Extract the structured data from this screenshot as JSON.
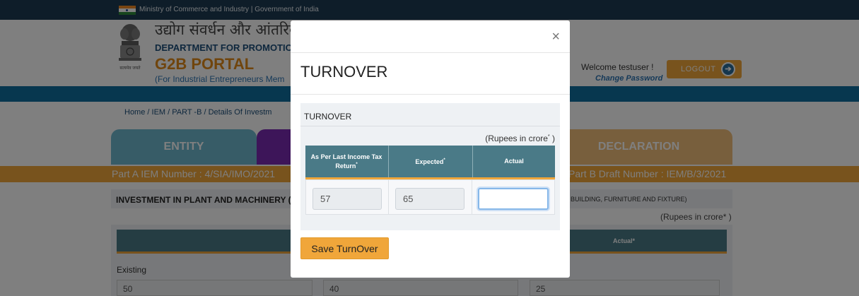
{
  "gov_strip": {
    "text": "Ministry of Commerce and Industry  |  Government of India"
  },
  "header": {
    "hindi_title": "उद्योग संवर्धन और आंतरिक",
    "dept_title": "DEPARTMENT FOR PROMOTION",
    "portal_title": "G2B PORTAL",
    "portal_subtitle": "(For Industrial Entrepreneurs Mem",
    "emblem_text": "सत्यमेव जयते",
    "welcome": "Welcome testuser !",
    "change_password": "Change Password",
    "logout": "LOGOUT"
  },
  "breadcrumb": "Home  /  IEM  /  PART -B  /  Details Of Investm",
  "tabs": {
    "entity": "ENTITY",
    "declaration": "DECLARATION"
  },
  "part_a": "Part A IEM Number :  4/SIA/IMO/2021",
  "part_b": "Part B Draft Number :  IEM/B/3/2021",
  "investment": {
    "title": "INVESTMENT IN PLANT AND MACHINERY (",
    "right_text": "BUILDING, FURNITURE AND FIXTURE)",
    "rupees": "(Rupees in crore* )",
    "actual_header": "Actual*",
    "existing_label": "Existing",
    "values": [
      "50",
      "40",
      "25"
    ]
  },
  "modal": {
    "close": "×",
    "title": "TURNOVER",
    "panel_heading": "TURNOVER",
    "rupees_note": "(Rupees in crore",
    "rupees_star": "*",
    "rupees_close": " )",
    "columns": {
      "col1": "As Per Last Income Tax Return",
      "col2": "Expected",
      "col3": "Actual",
      "star": "*"
    },
    "values": {
      "last_itr": "57",
      "expected": "65",
      "actual": ""
    },
    "save_button": "Save TurnOver"
  }
}
